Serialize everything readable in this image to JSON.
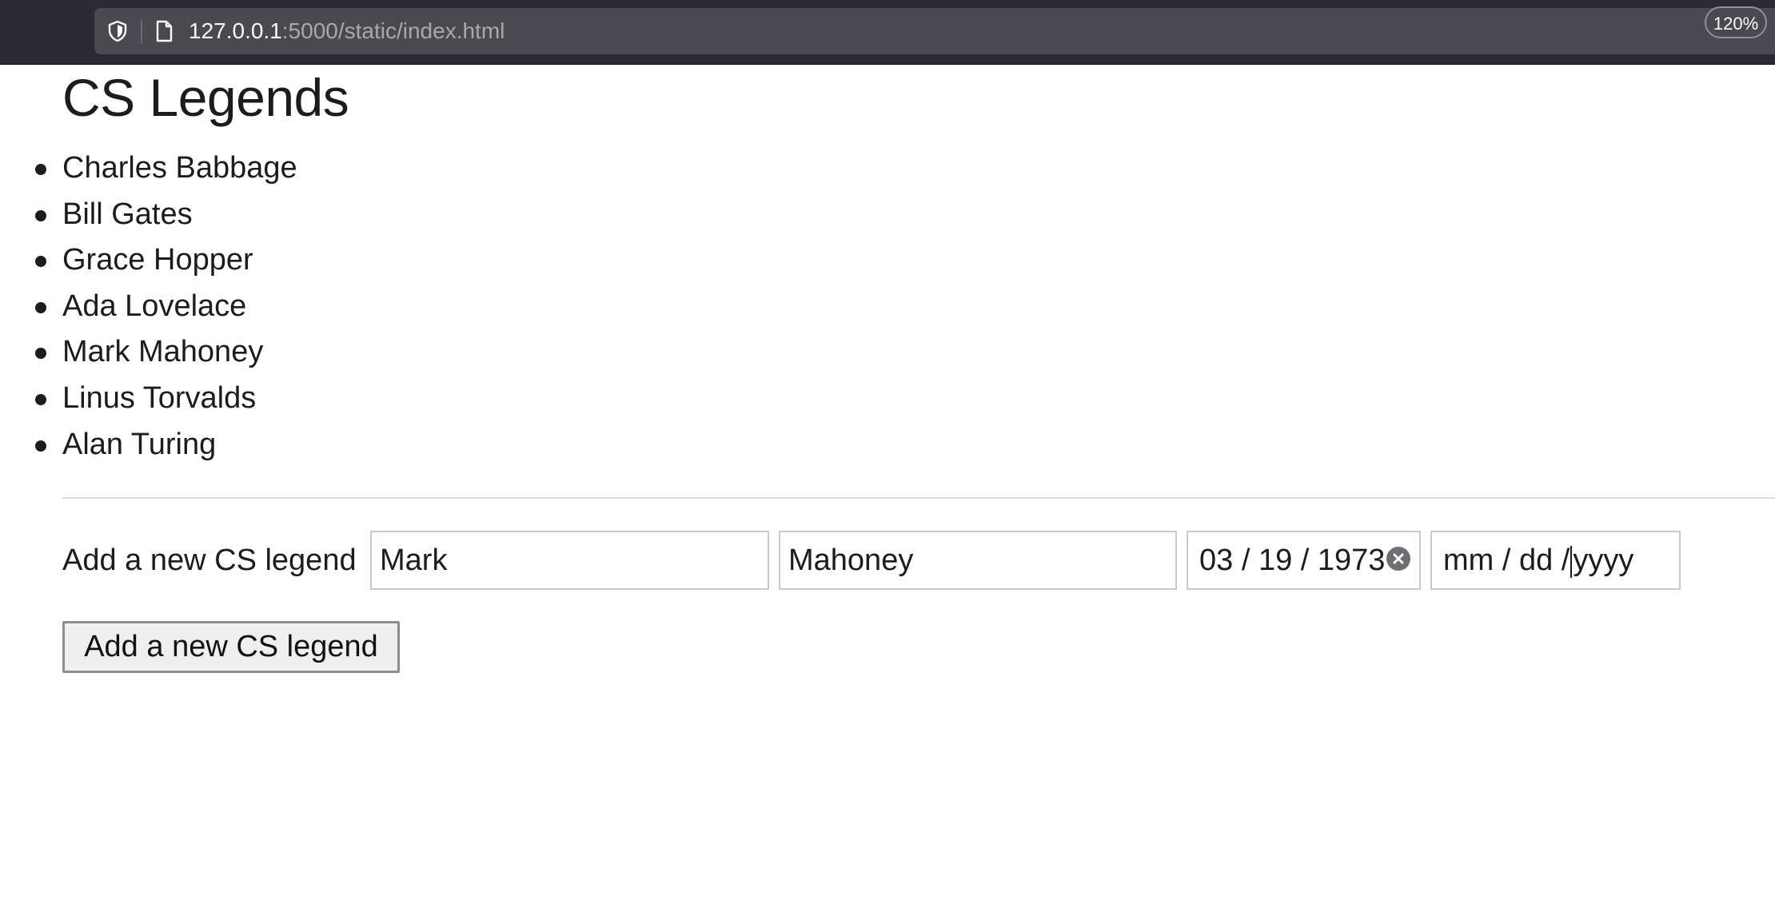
{
  "browser": {
    "url_host": "127.0.0.1",
    "url_rest": ":5000/static/index.html",
    "zoom": "120%"
  },
  "page": {
    "title": "CS Legends",
    "legends": [
      "Charles Babbage",
      "Bill Gates",
      "Grace Hopper",
      "Ada Lovelace",
      "Mark Mahoney",
      "Linus Torvalds",
      "Alan Turing"
    ]
  },
  "form": {
    "label": "Add a new CS legend",
    "first_name": "Mark",
    "last_name": "Mahoney",
    "birth_date": "03 / 19 / 1973",
    "death_date_left": "mm / dd /",
    "death_date_right": "yyyy",
    "submit_label": "Add a new CS legend"
  },
  "icons": {
    "tracking": "shield-icon",
    "page": "page-icon",
    "clear": "clear-circle-icon"
  }
}
